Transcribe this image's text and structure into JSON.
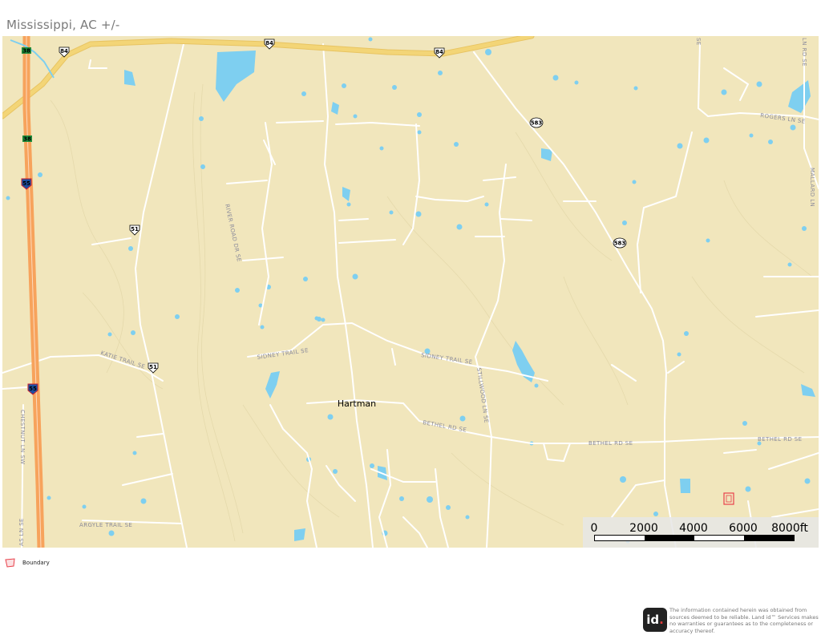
{
  "header": {
    "title": "Mississippi,  AC +/-"
  },
  "map": {
    "town_label": "Hartman",
    "road_labels": {
      "rogers": "ROGERS LN SE",
      "river_road": "RIVER ROAD DR SE",
      "katie": "KATIE TRAIL SE",
      "sidney_west": "SIDNEY TRAIL SE",
      "sidney_east": "SIDNEY TRAIL SE",
      "stillwood": "STILLWOOD LN SE",
      "bethel_mid": "BETHEL RD SE",
      "bethel_east": "BETHEL RD SE",
      "bethel_far": "BETHEL RD SE",
      "chestnut": "CHESTNUT LN SW",
      "argyle": "ARGYLE TRAIL SE",
      "mallard": "MALLARD LN",
      "top_right": "LN RD SE",
      "left_bottom": "AS LN SE",
      "top_mid": "SE"
    },
    "shields": {
      "us84_a": "84",
      "us84_b": "84",
      "us84_c": "84",
      "ms583_a": "583",
      "ms583_b": "583",
      "us51_a": "51",
      "us51_b": "51",
      "i55_a": "55",
      "i55_b": "55",
      "r38_a": "38",
      "r38_b": "38"
    },
    "colors": {
      "land": "#f1e6bc",
      "water": "#7ecff0",
      "minor_road": "#ffffff",
      "highway": "#f3d577",
      "interstate": "#f7a35c",
      "boundary": "#e8404a"
    }
  },
  "scale_bar": {
    "labels": [
      "0",
      "2000",
      "4000",
      "6000",
      "8000ft"
    ]
  },
  "legend": {
    "label": "Boundary"
  },
  "footer": {
    "logo_text": "id",
    "logo_dot": ".",
    "disclaimer": "The information contained herein was obtained from sources deemed to be reliable. Land id™ Services makes no warranties or guarantees as to the completeness or accuracy thereof."
  }
}
